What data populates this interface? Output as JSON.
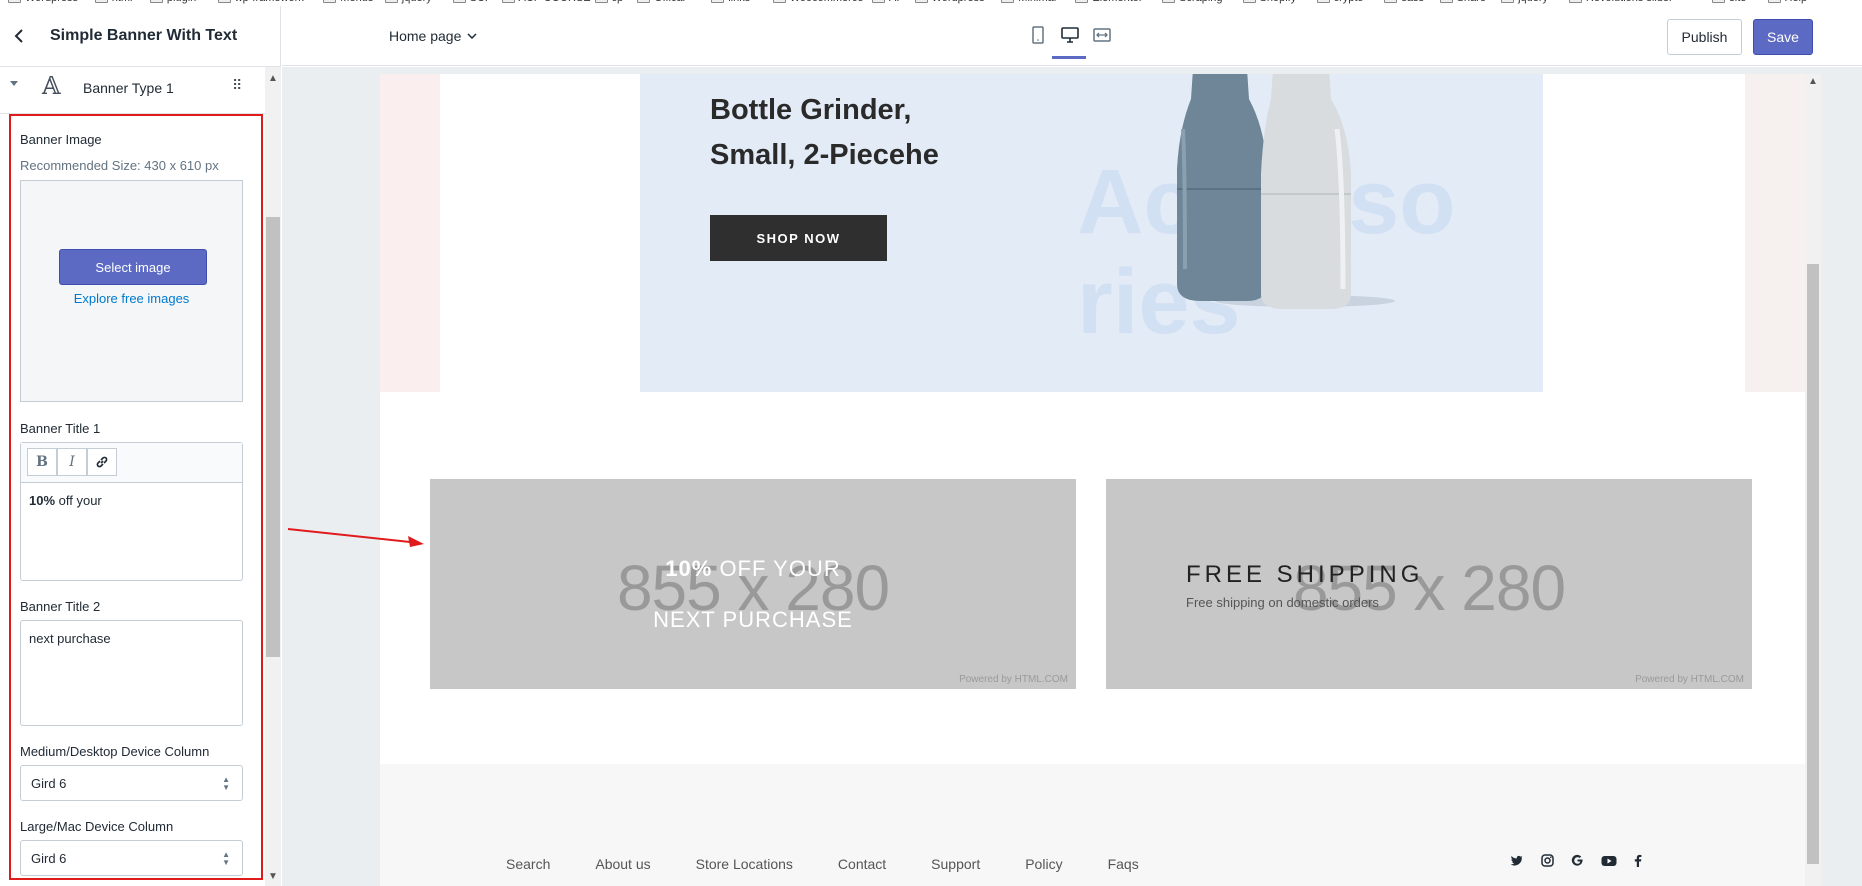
{
  "bookmarks": [
    "Wordpress",
    "html",
    "plugin",
    "wp-framework",
    "Menus",
    "jquery",
    "SCF",
    "ACF COURSE",
    "cp",
    "Offical",
    "links",
    "Woocommerce",
    "AI",
    "Wordpress",
    "Minimal",
    "Elementor",
    "Scraping",
    "Shopify",
    "crypto",
    "sass",
    "Share",
    "jquery",
    "Revolutions slider",
    "site",
    "Help"
  ],
  "sidebar": {
    "title": "Simple Banner With Text",
    "block": {
      "icon": "type-A-icon",
      "label": "Banner Type 1"
    },
    "banner_image_label": "Banner Image",
    "banner_image_help": "Recommended Size: 430 x 610 px",
    "select_image": "Select image",
    "explore_images": "Explore free images",
    "banner_title1_label": "Banner Title 1",
    "editor": {
      "bold": "B",
      "italic": "I",
      "bold_text": "10%",
      "rest_text": " off your"
    },
    "banner_title2_label": "Banner Title 2",
    "banner_title2_value": "next purchase",
    "medium_label": "Medium/Desktop Device Column",
    "medium_value": "Gird 6",
    "large_label": "Large/Mac Device Column",
    "large_value": "Gird 6"
  },
  "topbar": {
    "page_select": "Home page",
    "publish": "Publish",
    "save": "Save"
  },
  "preview": {
    "hero": {
      "title_line1": "Bottle Grinder,",
      "title_line2": "Small, 2-Piecehe",
      "bg_text_line1": "Accesso",
      "bg_text_line2": "ries",
      "cta": "SHOP NOW"
    },
    "tile1": {
      "placeholder": "855 x 280",
      "line1_bold": "10%",
      "line1_rest": " OFF YOUR",
      "line2": "NEXT PURCHASE",
      "powered": "Powered by HTML.COM"
    },
    "tile2": {
      "placeholder": "855 x 280",
      "title": "FREE SHIPPING",
      "subtitle": "Free shipping on domestic orders",
      "powered": "Powered by HTML.COM"
    },
    "footer_links": [
      "Search",
      "About us",
      "Store Locations",
      "Contact",
      "Support",
      "Policy",
      "Faqs"
    ],
    "social": [
      "twitter-icon",
      "instagram-icon",
      "google-icon",
      "youtube-icon",
      "facebook-icon"
    ]
  },
  "colors": {
    "accent": "#5c6ac4",
    "highlight": "#e01b1b"
  }
}
